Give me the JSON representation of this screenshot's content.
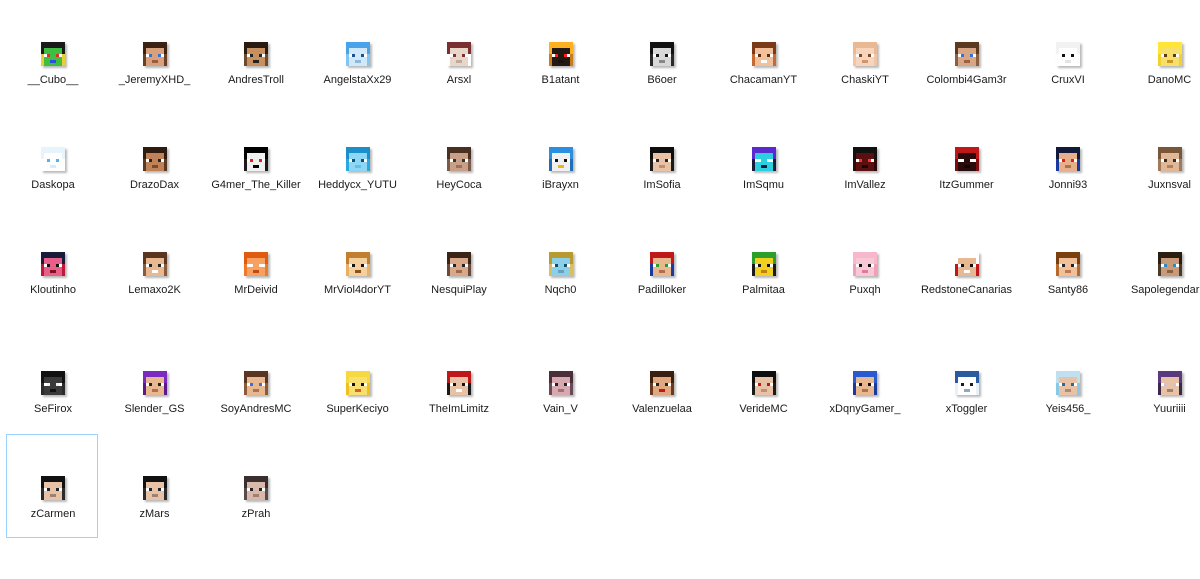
{
  "explorer": {
    "selected_item": "zCarmen",
    "items": [
      {
        "label": "__Cubo__",
        "icon": "skin-head-icon",
        "palette": {
          "base": "#e8d032",
          "hair": "#1a1a1a",
          "skin": "#3fbf3f",
          "eye": "#e02b2b",
          "mouth": "#2b4fe0"
        }
      },
      {
        "label": "_JeremyXHD_",
        "icon": "skin-head-icon",
        "palette": {
          "base": "#6b3f26",
          "hair": "#3b2212",
          "skin": "#d9a07c",
          "eye": "#3a6fd1",
          "mouth": "#9c5b3a"
        }
      },
      {
        "label": "AndresTroll",
        "icon": "skin-head-icon",
        "palette": {
          "base": "#6e4a2e",
          "hair": "#2a1b10",
          "skin": "#c9905f",
          "eye": "#222222",
          "mouth": "#222222"
        }
      },
      {
        "label": "AngelstaXx29",
        "icon": "skin-head-icon",
        "palette": {
          "base": "#7fc5f5",
          "hair": "#4aa3e8",
          "skin": "#cfe9fb",
          "eye": "#1e4f8f",
          "mouth": "#8fb7d9"
        }
      },
      {
        "label": "Arsxl",
        "icon": "skin-head-icon",
        "palette": {
          "base": "#ffffff",
          "hair": "#7a3030",
          "skin": "#e8d6c8",
          "eye": "#7a3030",
          "mouth": "#bfaaa0"
        }
      },
      {
        "label": "B1atant",
        "icon": "skin-head-icon",
        "palette": {
          "base": "#c97c1c",
          "hair": "#ffb020",
          "skin": "#221a12",
          "eye": "#ff2020",
          "mouth": "#1a120c"
        }
      },
      {
        "label": "B6oer",
        "icon": "skin-head-icon",
        "palette": {
          "base": "#2a2a2a",
          "hair": "#111111",
          "skin": "#d8d8d8",
          "eye": "#111111",
          "mouth": "#888888"
        }
      },
      {
        "label": "ChacamanYT",
        "icon": "skin-head-icon",
        "palette": {
          "base": "#c8692f",
          "hair": "#7a3a17",
          "skin": "#f2c09a",
          "eye": "#5a2a0e",
          "mouth": "#ffffff"
        }
      },
      {
        "label": "ChaskiYT",
        "icon": "skin-head-icon",
        "palette": {
          "base": "#efc5a6",
          "hair": "#e9b894",
          "skin": "#f7d4ba",
          "eye": "#7a4a2a",
          "mouth": "#d19470"
        }
      },
      {
        "label": "Colombi4Gam3r",
        "icon": "skin-head-icon",
        "palette": {
          "base": "#8a6040",
          "hair": "#5a3a20",
          "skin": "#d8a682",
          "eye": "#3a6fd1",
          "mouth": "#9a6040"
        }
      },
      {
        "label": "CruxVI",
        "icon": "skin-head-icon",
        "palette": {
          "base": "#ffffff",
          "hair": "#f2f2f2",
          "skin": "#ffffff",
          "eye": "#111111",
          "mouth": "#e4e4e4"
        }
      },
      {
        "label": "DanoMC",
        "icon": "skin-head-icon",
        "palette": {
          "base": "#f2d22a",
          "hair": "#ffe43a",
          "skin": "#f6df6a",
          "eye": "#5a3a10",
          "mouth": "#c89a20"
        }
      },
      {
        "label": "Daskopa",
        "icon": "skin-head-icon",
        "palette": {
          "base": "#ffffff",
          "hair": "#e8f4fb",
          "skin": "#ffffff",
          "eye": "#56b3ea",
          "mouth": "#d6ecf8"
        }
      },
      {
        "label": "DrazoDax",
        "icon": "skin-head-icon",
        "palette": {
          "base": "#5a3a1e",
          "hair": "#2e1c0e",
          "skin": "#c08258",
          "eye": "#222222",
          "mouth": "#7a4a2a"
        }
      },
      {
        "label": "G4mer_The_Killer",
        "icon": "skin-head-icon",
        "palette": {
          "base": "#1a1a1a",
          "hair": "#000000",
          "skin": "#f0f0f0",
          "eye": "#e02020",
          "mouth": "#000000"
        }
      },
      {
        "label": "Heddycx_YUTU",
        "icon": "skin-head-icon",
        "palette": {
          "base": "#2aa8e0",
          "hair": "#1b8fc9",
          "skin": "#8fd6f5",
          "eye": "#0b4f7a",
          "mouth": "#5fc0ea"
        }
      },
      {
        "label": "HeyCoca",
        "icon": "skin-head-icon",
        "palette": {
          "base": "#7a5a4a",
          "hair": "#4a3020",
          "skin": "#c8a088",
          "eye": "#333333",
          "mouth": "#9a7060"
        }
      },
      {
        "label": "iBrayxn",
        "icon": "skin-head-icon",
        "palette": {
          "base": "#1e6fb8",
          "hair": "#2a8fe0",
          "skin": "#f0f0f0",
          "eye": "#111111",
          "mouth": "#f2b21a"
        }
      },
      {
        "label": "ImSofia",
        "icon": "skin-head-icon",
        "palette": {
          "base": "#1a1a1a",
          "hair": "#0e0e0e",
          "skin": "#e8c2a6",
          "eye": "#222222",
          "mouth": "#c09070"
        }
      },
      {
        "label": "ImSqmu",
        "icon": "skin-head-icon",
        "palette": {
          "base": "#1a1a3a",
          "hair": "#5a2ad0",
          "skin": "#2ad0e0",
          "eye": "#ffffff",
          "mouth": "#1a1a3a"
        }
      },
      {
        "label": "ImVallez",
        "icon": "skin-head-icon",
        "palette": {
          "base": "#2a0a0a",
          "hair": "#111111",
          "skin": "#5a1010",
          "eye": "#ff3030",
          "mouth": "#1a0505"
        }
      },
      {
        "label": "ItzGummer",
        "icon": "skin-head-icon",
        "palette": {
          "base": "#7a0e0e",
          "hair": "#c01818",
          "skin": "#2a0a0a",
          "eye": "#ffffff",
          "mouth": "#100404"
        }
      },
      {
        "label": "Jonni93",
        "icon": "skin-head-icon",
        "palette": {
          "base": "#1a3aa0",
          "hair": "#111a3a",
          "skin": "#e8b08a",
          "eye": "#e02020",
          "mouth": "#b07050"
        }
      },
      {
        "label": "Juxnsval",
        "icon": "skin-head-icon",
        "palette": {
          "base": "#a07a5a",
          "hair": "#7a5638",
          "skin": "#e0b898",
          "eye": "#3a2a1a",
          "mouth": "#b08060"
        }
      },
      {
        "label": "Kloutinho",
        "icon": "skin-head-icon",
        "palette": {
          "base": "#c01838",
          "hair": "#1a1a3a",
          "skin": "#e8608a",
          "eye": "#111111",
          "mouth": "#801020"
        }
      },
      {
        "label": "Lemaxo2K",
        "icon": "skin-head-icon",
        "palette": {
          "base": "#8a5a3a",
          "hair": "#5a3520",
          "skin": "#e8b890",
          "eye": "#222222",
          "mouth": "#ffffff"
        }
      },
      {
        "label": "MrDeivid",
        "icon": "skin-head-icon",
        "palette": {
          "base": "#f07a2a",
          "hair": "#e05a10",
          "skin": "#f8a060",
          "eye": "#ffffff",
          "mouth": "#c04a10"
        }
      },
      {
        "label": "MrViol4dorYT",
        "icon": "skin-head-icon",
        "palette": {
          "base": "#e8b060",
          "hair": "#c08030",
          "skin": "#f6d09a",
          "eye": "#111111",
          "mouth": "#8a5020"
        }
      },
      {
        "label": "NesquiPlay",
        "icon": "skin-head-icon",
        "palette": {
          "base": "#6a4a3a",
          "hair": "#3a2418",
          "skin": "#d8a888",
          "eye": "#222222",
          "mouth": "#9a6a50"
        }
      },
      {
        "label": "Nqch0",
        "icon": "skin-head-icon",
        "palette": {
          "base": "#d8c060",
          "hair": "#b89a30",
          "skin": "#8ad0e8",
          "eye": "#1a4a6a",
          "mouth": "#6aa0b8"
        }
      },
      {
        "label": "Padilloker",
        "icon": "skin-head-icon",
        "palette": {
          "base": "#1a3aa0",
          "hair": "#c01818",
          "skin": "#e8b890",
          "eye": "#2aa02a",
          "mouth": "#b07050"
        }
      },
      {
        "label": "Palmitaa",
        "icon": "skin-head-icon",
        "palette": {
          "base": "#1a1a1a",
          "hair": "#2aa02a",
          "skin": "#f0d020",
          "eye": "#111111",
          "mouth": "#c08010"
        }
      },
      {
        "label": "Puxqh",
        "icon": "skin-head-icon",
        "palette": {
          "base": "#f2a0b8",
          "hair": "#f6b8ca",
          "skin": "#f8c8d6",
          "eye": "#111111",
          "mouth": "#e07a98"
        }
      },
      {
        "label": "RedstoneCanarias",
        "icon": "skin-head-icon",
        "palette": {
          "base": "#c01818",
          "hair": "#ffffff",
          "skin": "#e8b890",
          "eye": "#111111",
          "mouth": "#ffffff"
        }
      },
      {
        "label": "Santy86",
        "icon": "skin-head-icon",
        "palette": {
          "base": "#b86a2a",
          "hair": "#7a4010",
          "skin": "#f2c098",
          "eye": "#222222",
          "mouth": "#c07850"
        }
      },
      {
        "label": "Sapolegendario",
        "icon": "skin-head-icon",
        "palette": {
          "base": "#4a3a2a",
          "hair": "#2a1e12",
          "skin": "#c89a78",
          "eye": "#2a8ac8",
          "mouth": "#8a6040"
        }
      },
      {
        "label": "SeFirox",
        "icon": "skin-head-icon",
        "palette": {
          "base": "#2a2a2a",
          "hair": "#111111",
          "skin": "#3a3a3a",
          "eye": "#f0f0f0",
          "mouth": "#111111"
        }
      },
      {
        "label": "Slender_GS",
        "icon": "skin-head-icon",
        "palette": {
          "base": "#5a1a8a",
          "hair": "#7a2ac0",
          "skin": "#e8b890",
          "eye": "#222222",
          "mouth": "#b07050"
        }
      },
      {
        "label": "SoyAndresMC",
        "icon": "skin-head-icon",
        "palette": {
          "base": "#8a5a3a",
          "hair": "#5a3520",
          "skin": "#e8b890",
          "eye": "#3a6fd1",
          "mouth": "#b07050"
        }
      },
      {
        "label": "SuperKeciyo",
        "icon": "skin-head-icon",
        "palette": {
          "base": "#f0c020",
          "hair": "#f6d840",
          "skin": "#f8e070",
          "eye": "#111111",
          "mouth": "#e05a30"
        }
      },
      {
        "label": "TheImLimitz",
        "icon": "skin-head-icon",
        "palette": {
          "base": "#1a1a1a",
          "hair": "#c01818",
          "skin": "#e8c2a6",
          "eye": "#111111",
          "mouth": "#ffffff"
        }
      },
      {
        "label": "Vain_V",
        "icon": "skin-head-icon",
        "palette": {
          "base": "#6a4a5a",
          "hair": "#4a2e3a",
          "skin": "#d8a8b0",
          "eye": "#222222",
          "mouth": "#a07080"
        }
      },
      {
        "label": "Valenzuelaa",
        "icon": "skin-head-icon",
        "palette": {
          "base": "#6a3a1e",
          "hair": "#3a1e0e",
          "skin": "#e0a880",
          "eye": "#222222",
          "mouth": "#c01818"
        }
      },
      {
        "label": "VerideMC",
        "icon": "skin-head-icon",
        "palette": {
          "base": "#1a1a1a",
          "hair": "#0e0e0e",
          "skin": "#e8c2a6",
          "eye": "#c01818",
          "mouth": "#c09070"
        }
      },
      {
        "label": "xDqnyGamer_",
        "icon": "skin-head-icon",
        "palette": {
          "base": "#1a3aa0",
          "hair": "#2a5ad0",
          "skin": "#e8b890",
          "eye": "#111111",
          "mouth": "#b07050"
        }
      },
      {
        "label": "xToggler",
        "icon": "skin-head-icon",
        "palette": {
          "base": "#e8f0f8",
          "hair": "#2a5aa0",
          "skin": "#ffffff",
          "eye": "#1a1a1a",
          "mouth": "#8aa8c8"
        }
      },
      {
        "label": "Yeis456_",
        "icon": "skin-head-icon",
        "palette": {
          "base": "#8ac8e8",
          "hair": "#c0e0f0",
          "skin": "#e8c2a6",
          "eye": "#2a6a9a",
          "mouth": "#b08a70"
        }
      },
      {
        "label": "Yuuriiii",
        "icon": "skin-head-icon",
        "palette": {
          "base": "#3a2a4a",
          "hair": "#5a3a7a",
          "skin": "#e8c2a6",
          "eye": "#d0c0e0",
          "mouth": "#a08070"
        }
      },
      {
        "label": "zCarmen",
        "icon": "skin-head-icon",
        "palette": {
          "base": "#2a2a2a",
          "hair": "#111111",
          "skin": "#e8c2a6",
          "eye": "#222222",
          "mouth": "#a08070"
        }
      },
      {
        "label": "zMars",
        "icon": "skin-head-icon",
        "palette": {
          "base": "#2a2a2a",
          "hair": "#111111",
          "skin": "#e8c2a6",
          "eye": "#222222",
          "mouth": "#a08070"
        }
      },
      {
        "label": "zPrah",
        "icon": "skin-head-icon",
        "palette": {
          "base": "#5a4a4a",
          "hair": "#3a2e2e",
          "skin": "#d8b8a8",
          "eye": "#222222",
          "mouth": "#a08070"
        }
      }
    ]
  }
}
